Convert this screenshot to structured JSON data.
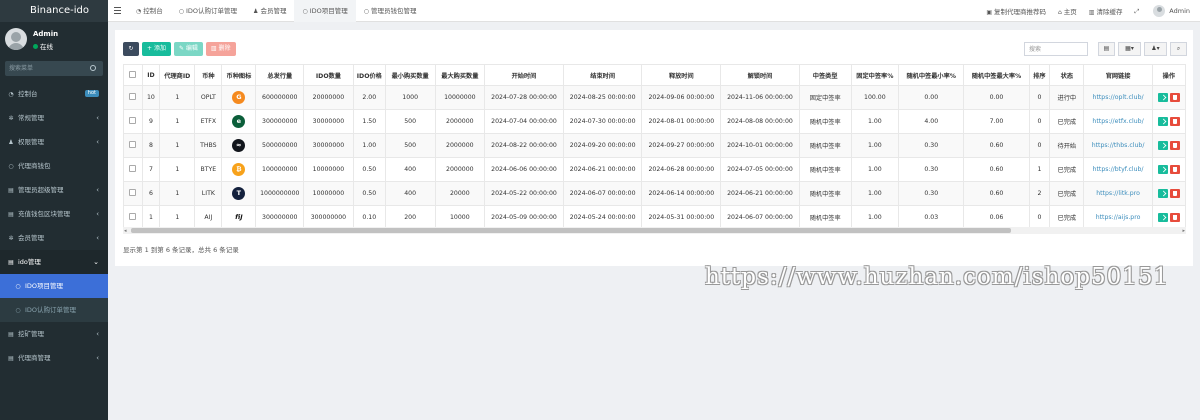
{
  "app": {
    "brand": "Binance-ido"
  },
  "user": {
    "name": "Admin",
    "status": "在线"
  },
  "sidebar": {
    "search_placeholder": "搜索菜单",
    "items": [
      {
        "label": "控制台",
        "badge": "hot"
      },
      {
        "label": "常规管理"
      },
      {
        "label": "权限管理"
      },
      {
        "label": "代理商钱包"
      },
      {
        "label": "管理员超级管理"
      },
      {
        "label": "充值钱包区块管理"
      },
      {
        "label": "会员管理"
      },
      {
        "label": "ido管理"
      },
      {
        "label": "IDO项目管理"
      },
      {
        "label": "IDO认购订单管理"
      },
      {
        "label": "挖矿管理"
      },
      {
        "label": "代理商管理"
      }
    ]
  },
  "topnav": {
    "tabs": [
      "控制台",
      "IDO认购订单管理",
      "会员管理",
      "IDO项目管理",
      "管理员钱包管理"
    ],
    "right": {
      "copy_link": "复制代理商推荐码",
      "home": "主页",
      "clear_cache": "清除缓存",
      "user": "Admin"
    }
  },
  "toolbar": {
    "add": "添加",
    "edit": "编辑",
    "delete": "删除",
    "search_placeholder": "搜索"
  },
  "table": {
    "headers": [
      "ID",
      "代理商ID",
      "币种",
      "币种图标",
      "总发行量",
      "IDO数量",
      "IDO价格",
      "最小购买数量",
      "最大购买数量",
      "开始时间",
      "结束时间",
      "释放时间",
      "解锁时间",
      "中签类型",
      "固定中签率%",
      "随机中签最小率%",
      "随机中签最大率%",
      "排序",
      "状态",
      "官网链接",
      "操作"
    ],
    "rows": [
      {
        "id": "10",
        "agent_id": "1",
        "coin": "OPLT",
        "icon_color": "#f58a1f",
        "icon_glyph": "G",
        "total": "600000000",
        "ido_qty": "20000000",
        "price": "2.00",
        "min_buy": "1000",
        "max_buy": "10000000",
        "start": "2024-07-28 00:00:00",
        "end": "2024-08-25 00:00:00",
        "release": "2024-09-06 00:00:00",
        "unlock": "2024-11-06 00:00:00",
        "win_type": "固定中签率",
        "fixed_rate": "100.00",
        "rand_min": "0.00",
        "rand_max": "0.00",
        "sort": "0",
        "status": "进行中",
        "link": "https://oplt.club/"
      },
      {
        "id": "9",
        "agent_id": "1",
        "coin": "ETFX",
        "icon_color": "#0b5e3a",
        "icon_glyph": "e",
        "total": "300000000",
        "ido_qty": "30000000",
        "price": "1.50",
        "min_buy": "500",
        "max_buy": "2000000",
        "start": "2024-07-04 00:00:00",
        "end": "2024-07-30 00:00:00",
        "release": "2024-08-01 00:00:00",
        "unlock": "2024-08-08 00:00:00",
        "win_type": "随机中签率",
        "fixed_rate": "1.00",
        "rand_min": "4.00",
        "rand_max": "7.00",
        "sort": "0",
        "status": "已完成",
        "link": "https://etfx.club/"
      },
      {
        "id": "8",
        "agent_id": "1",
        "coin": "THBS",
        "icon_color": "#12161c",
        "icon_glyph": "≈",
        "total": "500000000",
        "ido_qty": "30000000",
        "price": "1.00",
        "min_buy": "500",
        "max_buy": "2000000",
        "start": "2024-08-22 00:00:00",
        "end": "2024-09-20 00:00:00",
        "release": "2024-09-27 00:00:00",
        "unlock": "2024-10-01 00:00:00",
        "win_type": "随机中签率",
        "fixed_rate": "1.00",
        "rand_min": "0.30",
        "rand_max": "0.60",
        "sort": "0",
        "status": "待开始",
        "link": "https://thbs.club/"
      },
      {
        "id": "7",
        "agent_id": "1",
        "coin": "BTYE",
        "icon_color": "#f7a21b",
        "icon_glyph": "₿",
        "total": "100000000",
        "ido_qty": "10000000",
        "price": "0.50",
        "min_buy": "400",
        "max_buy": "2000000",
        "start": "2024-06-06 00:00:00",
        "end": "2024-06-21 00:00:00",
        "release": "2024-06-28 00:00:00",
        "unlock": "2024-07-05 00:00:00",
        "win_type": "随机中签率",
        "fixed_rate": "1.00",
        "rand_min": "0.30",
        "rand_max": "0.60",
        "sort": "1",
        "status": "已完成",
        "link": "https://btyf.club/"
      },
      {
        "id": "6",
        "agent_id": "1",
        "coin": "LITK",
        "icon_color": "#14213d",
        "icon_glyph": "T",
        "total": "1000000000",
        "ido_qty": "10000000",
        "price": "0.50",
        "min_buy": "400",
        "max_buy": "20000",
        "start": "2024-05-22 00:00:00",
        "end": "2024-06-07 00:00:00",
        "release": "2024-06-14 00:00:00",
        "unlock": "2024-06-21 00:00:00",
        "win_type": "随机中签率",
        "fixed_rate": "1.00",
        "rand_min": "0.30",
        "rand_max": "0.60",
        "sort": "2",
        "status": "已完成",
        "link": "https://litk.pro"
      },
      {
        "id": "1",
        "agent_id": "1",
        "coin": "AIJ",
        "icon_color": "#ffffff",
        "icon_glyph": "fiJ",
        "total": "300000000",
        "ido_qty": "300000000",
        "price": "0.10",
        "min_buy": "200",
        "max_buy": "10000",
        "start": "2024-05-09 00:00:00",
        "end": "2024-05-24 00:00:00",
        "release": "2024-05-31 00:00:00",
        "unlock": "2024-06-07 00:00:00",
        "win_type": "随机中签率",
        "fixed_rate": "1.00",
        "rand_min": "0.03",
        "rand_max": "0.06",
        "sort": "0",
        "status": "已完成",
        "link": "https://aijs.pro"
      }
    ]
  },
  "footer": {
    "info": "显示第 1 到第 6 条记录，总共 6 条记录"
  },
  "watermark": "https://www.huzhan.com/ishop50151"
}
